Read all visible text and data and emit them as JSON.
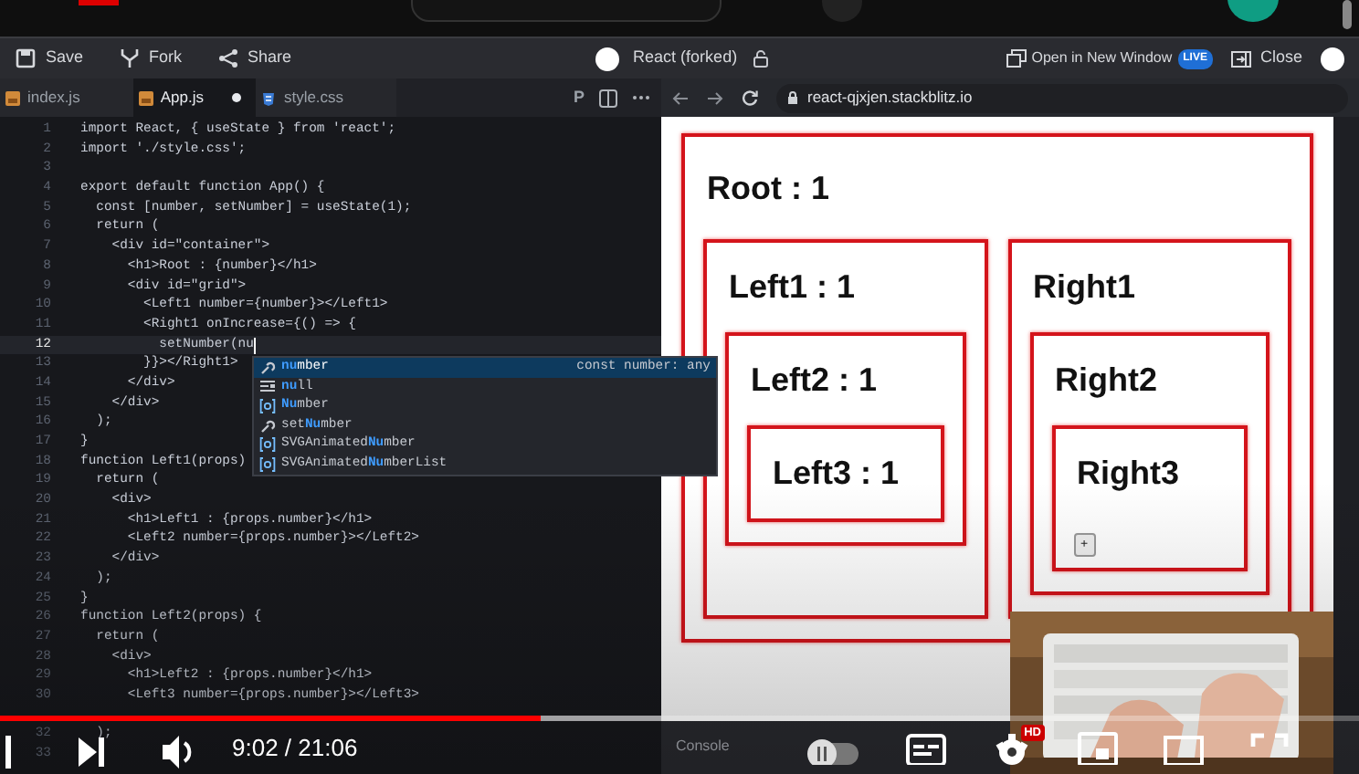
{
  "toolbar": {
    "actions": [
      {
        "kind": "save",
        "label": "Save"
      },
      {
        "kind": "fork",
        "label": "Fork"
      },
      {
        "kind": "share",
        "label": "Share"
      }
    ],
    "project": "React (forked)",
    "open_window": "Open in New Window",
    "live_badge": "LIVE",
    "close": "Close"
  },
  "editor_tabs": [
    {
      "kind": "js",
      "label": "index.js",
      "selected": false,
      "modified": false
    },
    {
      "kind": "js",
      "label": "App.js",
      "selected": true,
      "modified": true
    },
    {
      "kind": "css",
      "label": "style.css",
      "selected": false,
      "modified": false
    }
  ],
  "editor_toolbar": {
    "format_button": "P"
  },
  "code_lines": [
    {
      "kind": "code",
      "number": "1",
      "text": "import React, { useState } from 'react';",
      "current": false
    },
    {
      "kind": "code",
      "number": "2",
      "text": "import './style.css';",
      "current": false
    },
    {
      "kind": "code",
      "number": "3",
      "current": false
    },
    {
      "kind": "code",
      "number": "4",
      "text": "export default function App() {",
      "current": false
    },
    {
      "kind": "code",
      "number": "5",
      "text": "  const [number, setNumber] = useState(1);",
      "current": false
    },
    {
      "kind": "code",
      "number": "6",
      "text": "  return (",
      "current": false
    },
    {
      "kind": "code",
      "number": "7",
      "text": "    <div id=\"container\">",
      "current": false
    },
    {
      "kind": "code",
      "number": "8",
      "text": "      <h1>Root : {number}</h1>",
      "current": false
    },
    {
      "kind": "code",
      "number": "9",
      "text": "      <div id=\"grid\">",
      "current": false
    },
    {
      "kind": "code",
      "number": "10",
      "text": "        <Left1 number={number}></Left1>",
      "current": false
    },
    {
      "kind": "code",
      "number": "11",
      "text": "        <Right1 onIncrease={() => {",
      "current": false
    },
    {
      "kind": "code",
      "number": "12",
      "text": "          setNumber(nu",
      "current": true
    },
    {
      "kind": "code",
      "number": "13",
      "text": "        }}></Right1>",
      "current": false
    },
    {
      "kind": "code",
      "number": "14",
      "text": "      </div>",
      "current": false
    },
    {
      "kind": "code",
      "number": "15",
      "text": "    </div>",
      "current": false
    },
    {
      "kind": "code",
      "number": "16",
      "text": "  );",
      "current": false
    },
    {
      "kind": "code",
      "number": "17",
      "text": "}",
      "current": false
    },
    {
      "kind": "code",
      "number": "18",
      "text": "function Left1(props)",
      "current": false
    },
    {
      "kind": "code",
      "number": "19",
      "text": "  return (",
      "current": false
    },
    {
      "kind": "code",
      "number": "20",
      "text": "    <div>",
      "current": false
    },
    {
      "kind": "code",
      "number": "21",
      "text": "      <h1>Left1 : {props.number}</h1>",
      "current": false
    },
    {
      "kind": "code",
      "number": "22",
      "text": "      <Left2 number={props.number}></Left2>",
      "current": false
    },
    {
      "kind": "code",
      "number": "23",
      "text": "    </div>",
      "current": false
    },
    {
      "kind": "code",
      "number": "24",
      "text": "  );",
      "current": false
    },
    {
      "kind": "code",
      "number": "25",
      "text": "}",
      "current": false
    },
    {
      "kind": "code",
      "number": "26",
      "text": "function Left2(props) {",
      "current": false
    },
    {
      "kind": "code",
      "number": "27",
      "text": "  return (",
      "current": false
    },
    {
      "kind": "code",
      "number": "28",
      "text": "    <div>",
      "current": false
    },
    {
      "kind": "code",
      "number": "29",
      "text": "      <h1>Left2 : {props.number}</h1>",
      "current": false
    },
    {
      "kind": "code",
      "number": "30",
      "text": "      <Left3 number={props.number}></Left3>",
      "current": false
    },
    {
      "kind": "covered",
      "current": false
    },
    {
      "kind": "code",
      "number": "32",
      "text": "  );",
      "current": false
    },
    {
      "kind": "code",
      "number": "33",
      "current": false
    }
  ],
  "autocomplete": [
    {
      "kind": "field",
      "label": "**nu**mber",
      "detail": "const number: any",
      "selected": true
    },
    {
      "kind": "keyword",
      "label": "**nu**ll",
      "selected": false
    },
    {
      "kind": "variable",
      "label": "**Nu**mber",
      "selected": false
    },
    {
      "kind": "field",
      "label": "set**Nu**mber",
      "selected": false
    },
    {
      "kind": "variable",
      "label": "SVGAnimated**Nu**mber",
      "selected": false
    },
    {
      "kind": "variable",
      "label": "SVGAnimated**Nu**mberList",
      "selected": false
    }
  ],
  "browser": {
    "url": "react-qjxjen.stackblitz.io"
  },
  "preview": {
    "title": "Root : 1",
    "children": [
      {
        "title": "Left1 : 1",
        "children": [
          {
            "title": "Left2 : 1",
            "children": [
              {
                "title": "Left3 : 1"
              }
            ]
          }
        ]
      },
      {
        "title": "Right1",
        "children": [
          {
            "title": "Right2",
            "children": [
              {
                "title": "Right3",
                "button": "+"
              }
            ]
          }
        ]
      }
    ]
  },
  "console": {
    "label": "Console"
  },
  "player": {
    "progress": {
      "level": 0.398
    },
    "time": "9:02 / 21:06",
    "hd_badge": "HD"
  }
}
